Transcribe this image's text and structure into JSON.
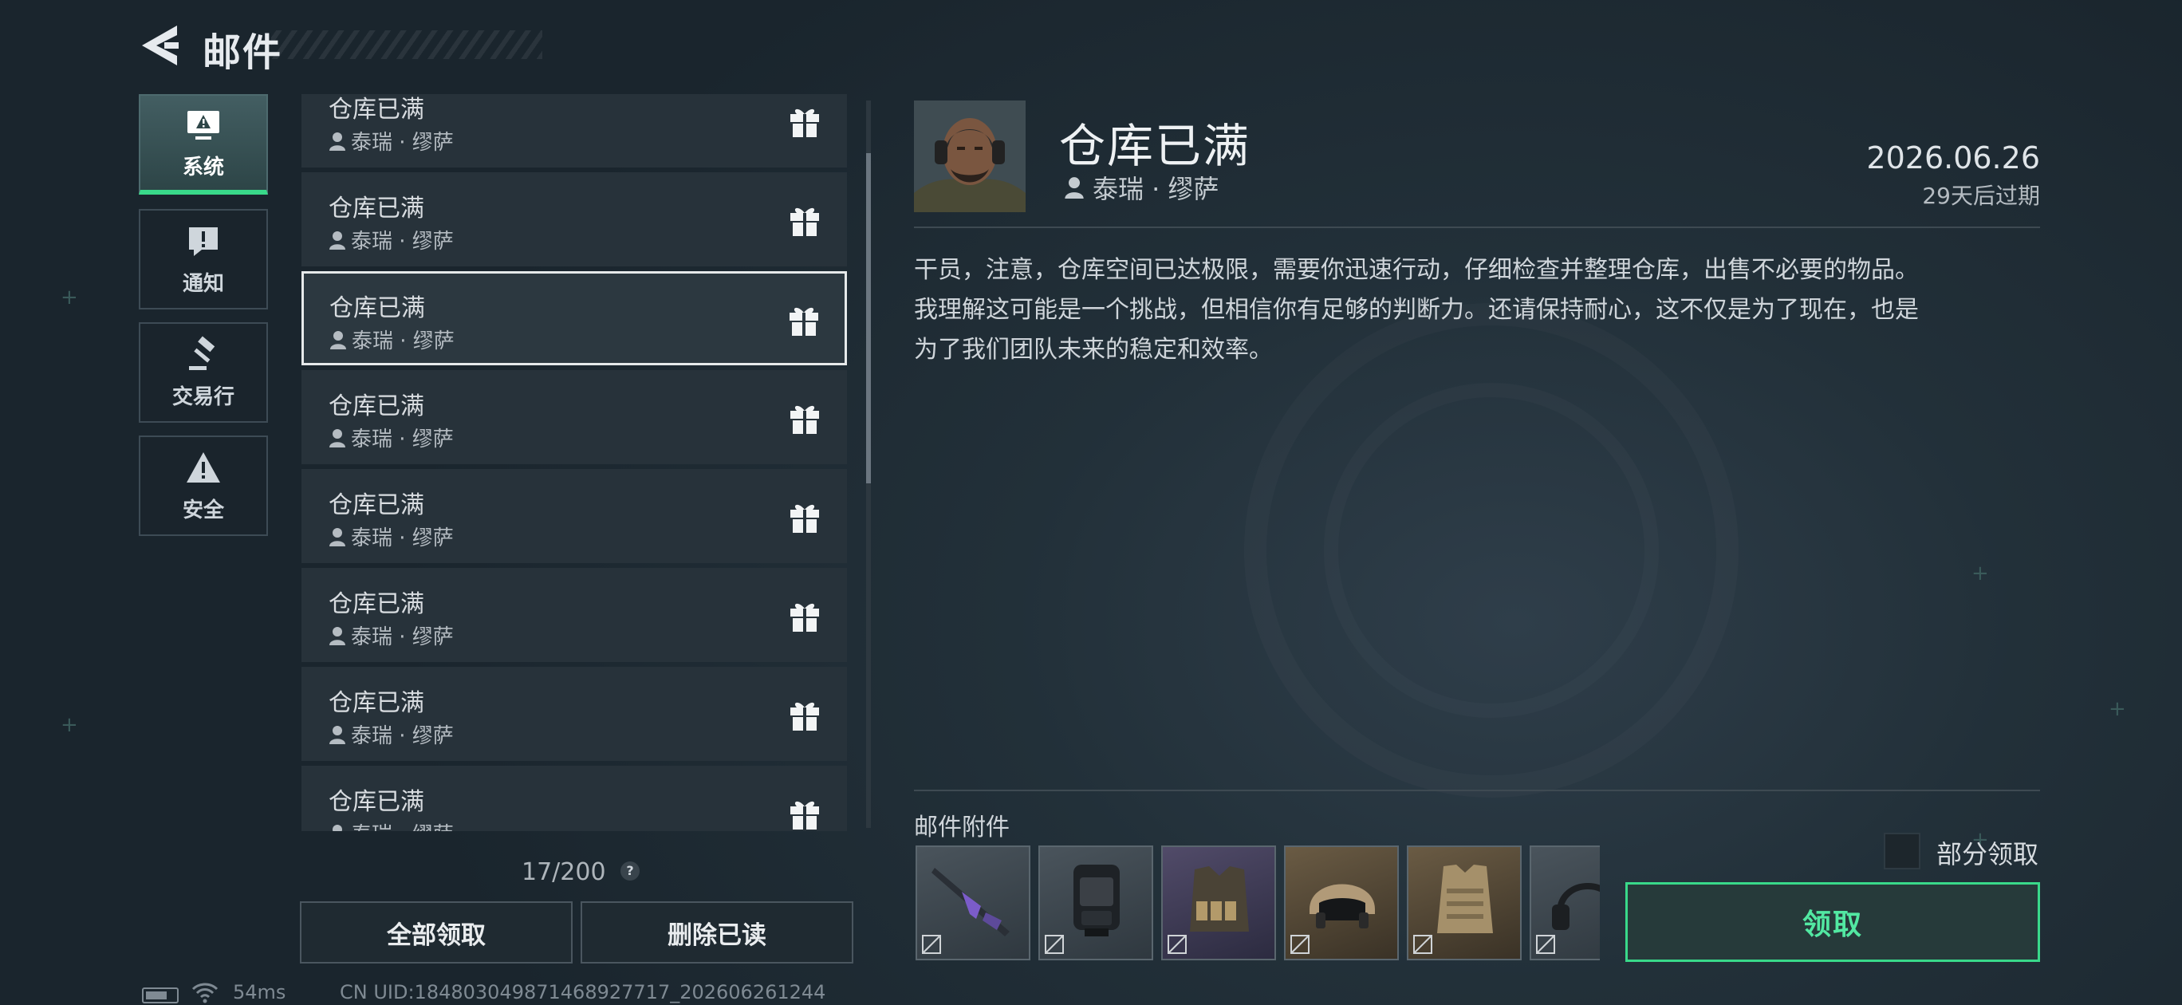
{
  "header": {
    "title": "邮件"
  },
  "tabs": [
    {
      "label": "系统",
      "icon": "monitor-alert-icon",
      "active": true
    },
    {
      "label": "通知",
      "icon": "speech-exclaim-icon",
      "active": false
    },
    {
      "label": "交易行",
      "icon": "gavel-icon",
      "active": false
    },
    {
      "label": "安全",
      "icon": "warning-triangle-icon",
      "active": false
    }
  ],
  "mails": [
    {
      "title": "仓库已满",
      "sender": "泰瑞 · 缪萨"
    },
    {
      "title": "仓库已满",
      "sender": "泰瑞 · 缪萨"
    },
    {
      "title": "仓库已满",
      "sender": "泰瑞 · 缪萨",
      "selected": true
    },
    {
      "title": "仓库已满",
      "sender": "泰瑞 · 缪萨"
    },
    {
      "title": "仓库已满",
      "sender": "泰瑞 · 缪萨"
    },
    {
      "title": "仓库已满",
      "sender": "泰瑞 · 缪萨"
    },
    {
      "title": "仓库已满",
      "sender": "泰瑞 · 缪萨"
    },
    {
      "title": "仓库已满",
      "sender": "泰瑞 · 缪萨"
    }
  ],
  "mail_count": "17/200",
  "help_glyph": "?",
  "buttons": {
    "claim_all": "全部领取",
    "delete_read": "删除已读",
    "claim": "领取"
  },
  "status_bar": {
    "ping": "54ms",
    "uid": "CN UID:184803049871468927717_202606261244"
  },
  "detail": {
    "title": "仓库已满",
    "sender": "泰瑞 · 缪萨",
    "date": "2026.06.26",
    "expire": "29天后过期",
    "body_lines": [
      "干员，注意，仓库空间已达极限，需要你迅速行动，仔细检查并整理仓库，出售不必要的物品。",
      "我理解这可能是一个挑战，但相信你有足够的判断力。还请保持耐心，这不仅是为了现在，也是",
      "为了我们团队未来的稳定和效率。"
    ],
    "attachments_label": "邮件附件",
    "attachments": [
      {
        "icon": "rifle-icon",
        "tint": "gray"
      },
      {
        "icon": "backpack-icon",
        "tint": "gray"
      },
      {
        "icon": "tactical-vest-icon",
        "tint": "purple"
      },
      {
        "icon": "helmet-icon",
        "tint": "gold"
      },
      {
        "icon": "body-armor-icon",
        "tint": "gold"
      },
      {
        "icon": "headset-icon",
        "tint": "gray"
      }
    ],
    "partial_claim_label": "部分领取"
  },
  "colors": {
    "accent": "#39d98a",
    "claim_text": "#52e8a2",
    "panel": "#27323a",
    "selected_border": "#e6e9ea"
  }
}
